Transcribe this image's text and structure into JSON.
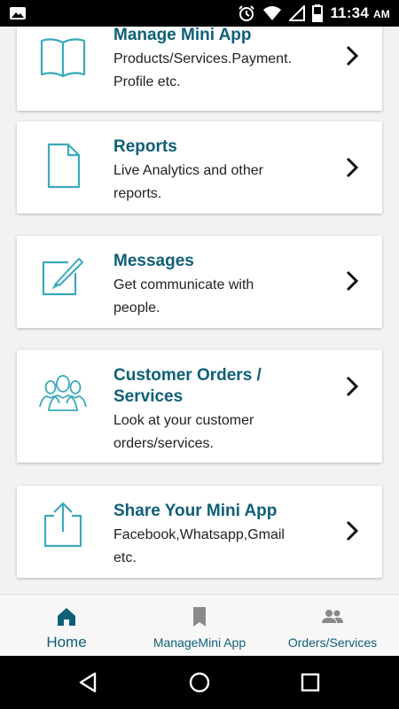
{
  "status_bar": {
    "time": "11:34",
    "ampm": "AM",
    "left_icon": "image-icon",
    "icons": [
      "alarm-icon",
      "wifi-icon",
      "signal-icon",
      "battery-icon"
    ]
  },
  "cards": [
    {
      "title": "Manage Mini App",
      "desc_line1": "Products/Services.Payment.",
      "desc_line2": "Profile etc.",
      "icon": "book-icon"
    },
    {
      "title": "Reports",
      "desc_line1": "Live Analytics and other",
      "desc_line2": "reports.",
      "icon": "document-icon"
    },
    {
      "title": "Messages",
      "desc_line1": "Get communicate with",
      "desc_line2": "people.",
      "icon": "edit-icon"
    },
    {
      "title_line1": "Customer Orders /",
      "title_line2": "Services",
      "desc_line1": "Look at your customer",
      "desc_line2": "orders/services.",
      "icon": "people-icon"
    },
    {
      "title": "Share Your Mini App",
      "desc_line1": "Facebook,Whatsapp,Gmail",
      "desc_line2": "etc.",
      "icon": "share-icon"
    }
  ],
  "bottom_nav": [
    {
      "label": "Home",
      "icon": "home-icon",
      "active": true
    },
    {
      "label": "ManageMini App",
      "icon": "bookmark-icon",
      "active": false
    },
    {
      "label": "Orders/Services",
      "icon": "group-icon",
      "active": false
    }
  ],
  "colors": {
    "accent": "#0f5f78",
    "icon_teal": "#3aaabb",
    "inactive_icon": "#8a8a8a"
  }
}
